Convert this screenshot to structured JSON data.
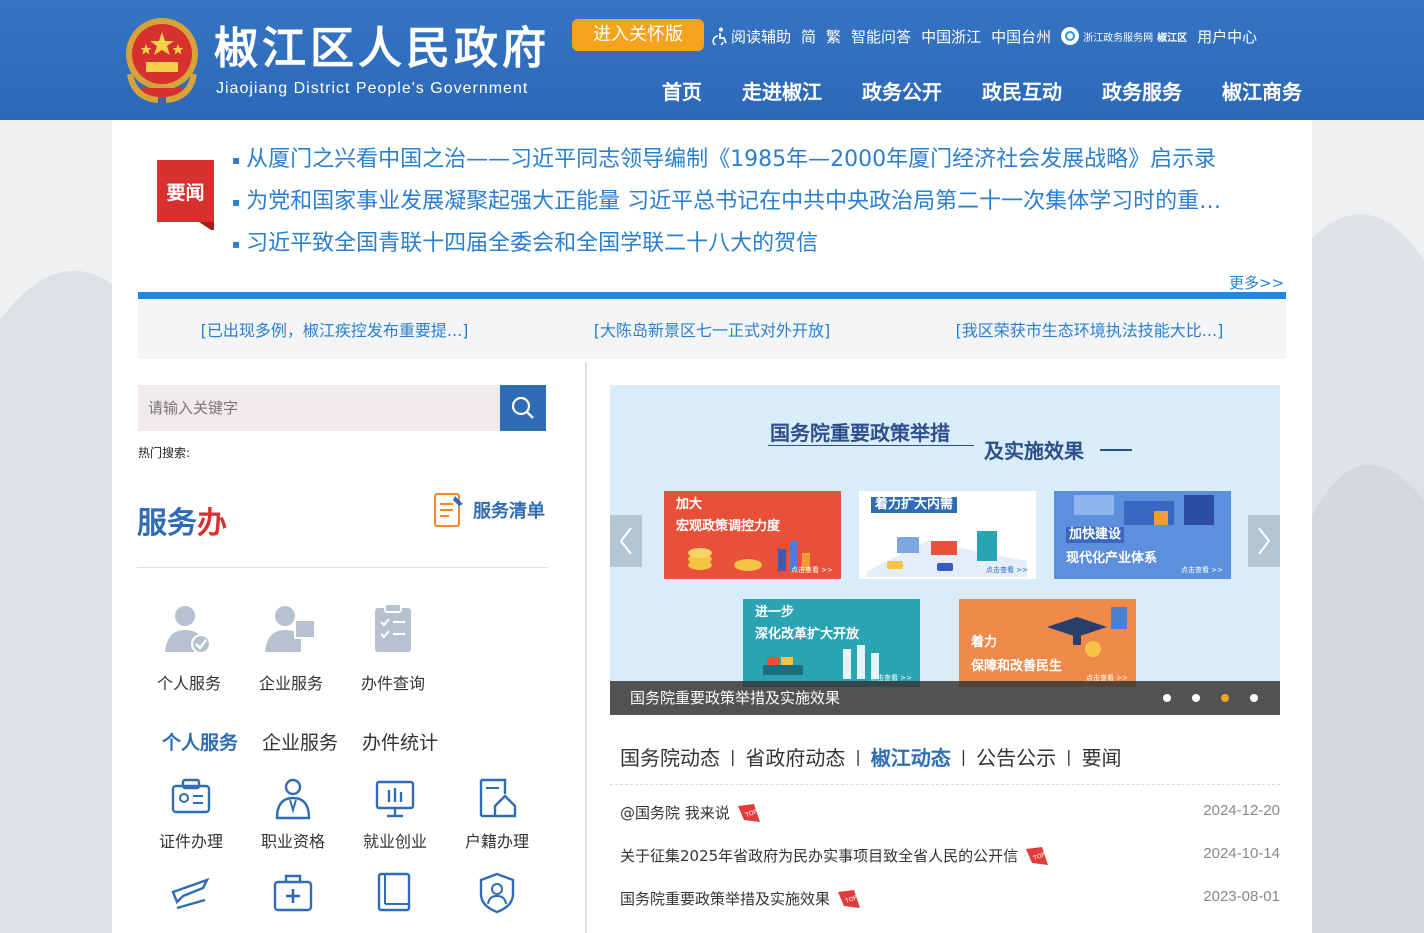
{
  "header": {
    "title": "椒江区人民政府",
    "subtitle": "Jiaojiang District People's Government",
    "care_button": "进入关怀版",
    "top_links": [
      "阅读辅助",
      "简",
      "繁",
      "智能问答",
      "中国浙江",
      "中国台州"
    ],
    "zj_service_logo": "浙江政务服务网",
    "zj_service_area": "椒江区",
    "user_center": "用户中心",
    "nav": [
      "首页",
      "走进椒江",
      "政务公开",
      "政民互动",
      "政务服务",
      "椒江商务"
    ]
  },
  "headline": {
    "badge": "要闻",
    "items": [
      "从厦门之兴看中国之治——习近平同志领导编制《1985年—2000年厦门经济社会发展战略》启示录",
      "为党和国家事业发展凝聚起强大正能量 习近平总书记在中共中央政治局第二十一次集体学习时的重…",
      "习近平致全国青联十四届全委会和全国学联二十八大的贺信"
    ],
    "more": "更多>>",
    "sub_items": [
      "[已出现多例，椒江疾控发布重要提...]",
      "[大陈岛新景区七一正式对外开放]",
      "[我区荣获市生态环境执法技能大比...]"
    ]
  },
  "search": {
    "placeholder": "请输入关键字",
    "hot_label": "热门搜索:"
  },
  "services": {
    "title_main": "服务",
    "title_accent": "办",
    "list_label": "服务清单",
    "big_icons": [
      "个人服务",
      "企业服务",
      "办件查询"
    ],
    "tabs": [
      "个人服务",
      "企业服务",
      "办件统计"
    ],
    "small_icons": [
      "证件办理",
      "职业资格",
      "就业创业",
      "户籍办理"
    ]
  },
  "carousel": {
    "heading_1": "国务院重要政策举措",
    "heading_2": "及实施效果",
    "cards": [
      {
        "line1": "加大",
        "line2": "宏观政策调控力度",
        "color": "#e8503a"
      },
      {
        "line1": "着力扩大内需",
        "line2": "",
        "color": "#ffffff"
      },
      {
        "line1": "加快建设",
        "line2": "现代化产业体系",
        "color": "#4a7fd1"
      },
      {
        "line1": "进一步",
        "line2": "深化改革扩大开放",
        "color": "#2aa3b3"
      },
      {
        "line1": "着力",
        "line2": "保障和改善民生",
        "color": "#f08a4b"
      }
    ],
    "card_cta": "点击查看 >>",
    "caption": "国务院重要政策举措及实施效果",
    "slide_count": 4,
    "active_slide": 3
  },
  "news_tabs": {
    "tabs": [
      "国务院动态",
      "省政府动态",
      "椒江动态",
      "公告公示",
      "要闻"
    ],
    "active": "椒江动态",
    "items": [
      {
        "title": "@国务院 我来说",
        "date": "2024-12-20"
      },
      {
        "title": "关于征集2025年省政府为民办实事项目致全省人民的公开信",
        "date": "2024-10-14"
      },
      {
        "title": "国务院重要政策举措及实施效果",
        "date": "2023-08-01"
      }
    ]
  },
  "colors": {
    "header_blue": "#2f6fc0",
    "accent_orange": "#f5a21c",
    "link_blue": "#2b7fd0",
    "badge_red": "#d6302f"
  }
}
